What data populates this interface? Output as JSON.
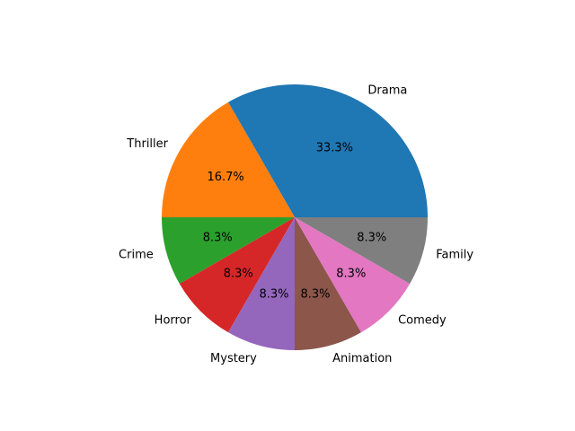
{
  "chart_data": {
    "type": "pie",
    "title": "",
    "categories": [
      "Drama",
      "Thriller",
      "Crime",
      "Horror",
      "Mystery",
      "Animation",
      "Comedy",
      "Family"
    ],
    "values": [
      4,
      2,
      1,
      1,
      1,
      1,
      1,
      1
    ],
    "percent_labels": [
      "33.3%",
      "16.7%",
      "8.3%",
      "8.3%",
      "8.3%",
      "8.3%",
      "8.3%",
      "8.3%"
    ],
    "colors": [
      "#1f77b4",
      "#ff7f0e",
      "#2ca02c",
      "#d62728",
      "#9467bd",
      "#8c564b",
      "#e377c2",
      "#7f7f7f"
    ],
    "start_angle_deg": 0,
    "direction": "counterclockwise",
    "legend": "none"
  }
}
